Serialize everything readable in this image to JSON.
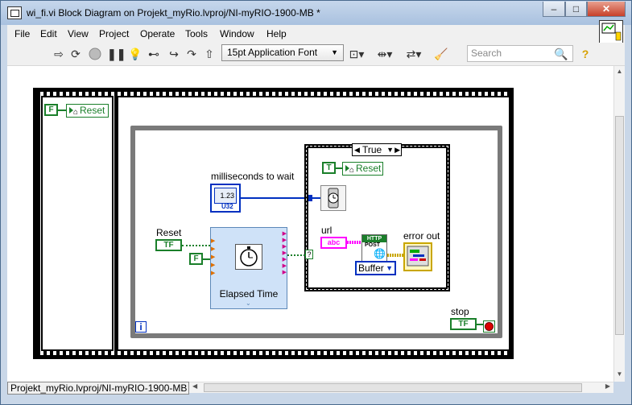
{
  "window": {
    "title": "wi_fi.vi Block Diagram on Projekt_myRio.lvproj/NI-myRIO-1900-MB *",
    "minimize": "–",
    "maximize": "□",
    "close": "✕"
  },
  "menu": {
    "items": [
      "File",
      "Edit",
      "View",
      "Project",
      "Operate",
      "Tools",
      "Window",
      "Help"
    ]
  },
  "toolbar": {
    "font": "15pt Application Font",
    "search_placeholder": "Search"
  },
  "diagram": {
    "false_const": "F",
    "reset_local": "Reset",
    "ms_to_wait_label": "milliseconds to wait",
    "ms_numeric": "1.23",
    "ms_type": "U32",
    "reset_label": "Reset",
    "tf": "TF",
    "elapsed_label": "Elapsed Time",
    "case_selector": "True",
    "true_const": "T",
    "url_label": "url",
    "url_type": "abc",
    "http_label": "HTTP",
    "post_label": "POST",
    "buffer": "Buffer",
    "error_out_label": "error out",
    "stop_label": "stop",
    "loop_iteration": "i",
    "question": "?"
  },
  "status": {
    "context": "Projekt_myRio.lvproj/NI-myRIO-1900-MB"
  },
  "colors": {
    "boolean": "#1a7f2a",
    "numeric": "#0030c0",
    "string": "#ff00ff",
    "error": "#ffd400",
    "loop": "#808080"
  }
}
